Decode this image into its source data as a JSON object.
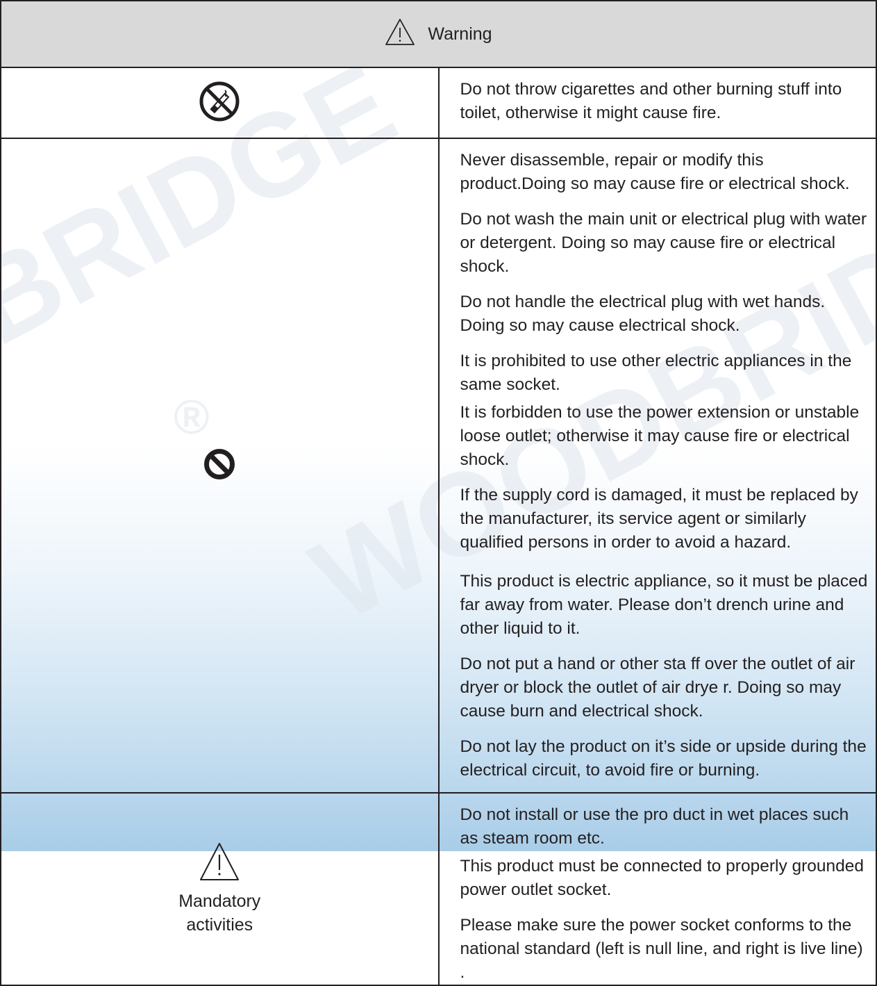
{
  "watermark": {
    "brand": "WOODBRIDGE",
    "mark": "®"
  },
  "header": {
    "title": "Warning"
  },
  "rows": [
    {
      "icon": "no-smoking-icon",
      "paragraphs": [
        "Do not throw cigarettes and other burning stuff into toilet, otherwise it might cause fire."
      ]
    },
    {
      "icon": "prohibited-icon",
      "paragraphs": [
        "Never disassemble, repair or modify this product.Doing so may cause fire or electrical shock.",
        "Do not wash the main unit or electrical plug with water or detergent. Doing so may cause fire or electrical shock.",
        "Do not handle the electrical plug with wet hands. Doing so may cause electrical shock.",
        "It is prohibited to use other electric appliances in the same socket.",
        "It is forbidden to use the power extension or unstable loose outlet; otherwise it may cause fire or electrical shock.",
        "If the supply cord is damaged, it must be replaced by the manufacturer, its service agent or similarly qualified persons in order to avoid a hazard.",
        "This product is electric appliance, so it must be placed far away from water. Please don’t drench urine and other liquid to it.",
        "Do not put a hand or other sta  ff over the outlet of air dryer or block the outlet of air drye  r. Doing so may cause burn and electrical shock.",
        "Do not lay the product on it’s side or upside during the electrical circuit, to avoid fire or burning."
      ]
    },
    {
      "icon": "warning-triangle-icon",
      "label_line1": "Mandatory",
      "label_line2": "activities",
      "paragraphs": [
        "Do not install or use the pro  duct in wet places such as steam room etc.",
        "This product must be connected to properly grounded power outlet socket.",
        "Please make sure the power socket conforms to the national standard (left is null line,  and right is live line) ."
      ]
    }
  ]
}
